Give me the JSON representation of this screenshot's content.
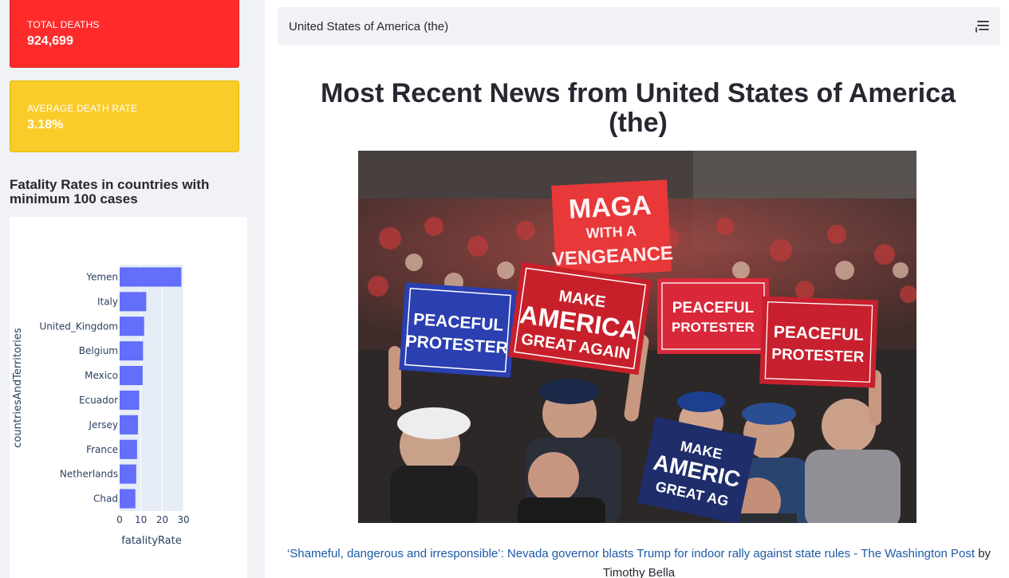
{
  "sidebar": {
    "total_deaths": {
      "label": "TOTAL DEATHS",
      "value": "924,699",
      "color": "#ff2b2b"
    },
    "average_death_rate": {
      "label": "AVERAGE DEATH RATE",
      "value": "3.18%",
      "color": "#facc2a"
    },
    "chart_title": "Fatality Rates in countries with minimum 100 cases"
  },
  "chart_data": {
    "type": "bar",
    "orientation": "horizontal",
    "categories": [
      "Yemen",
      "Italy",
      "United_Kingdom",
      "Belgium",
      "Mexico",
      "Ecuador",
      "Jersey",
      "France",
      "Netherlands",
      "Chad"
    ],
    "values": [
      29,
      12.5,
      11.5,
      11,
      10.8,
      9.2,
      8.6,
      8.2,
      7.8,
      7.4
    ],
    "xlabel": "fatalityRate",
    "ylabel": "countriesAndTerritories",
    "xticks": [
      "0",
      "10",
      "20",
      "30"
    ],
    "xlim": [
      0,
      30
    ],
    "bar_color": "#636efa",
    "plot_bg": "#e5ecf6"
  },
  "main": {
    "country_select": {
      "value": "United States of America (the)",
      "icon": "list-filter-icon"
    },
    "news_title": "Most Recent News from United States of America (the)",
    "image": {
      "signs": [
        {
          "lines": [
            "MAGA",
            "WITH A",
            "VENGEANCE"
          ]
        },
        {
          "lines": [
            "PEACEFUL",
            "PROTESTER"
          ]
        },
        {
          "lines": [
            "MAKE",
            "AMERICA",
            "GREAT AGAIN"
          ]
        },
        {
          "lines": [
            "PEACEFUL",
            "PROTESTER"
          ]
        },
        {
          "lines": [
            "PEACEFUL",
            "PROTESTER"
          ]
        },
        {
          "lines": [
            "MAKE",
            "AMERIC",
            "GREAT AG"
          ]
        }
      ]
    },
    "article": {
      "headline": "‘Shameful, dangerous and irresponsible’: Nevada governor blasts Trump for indoor rally against state rules - The Washington Post",
      "byline_prefix": "by",
      "author": "Timothy Bella"
    }
  }
}
